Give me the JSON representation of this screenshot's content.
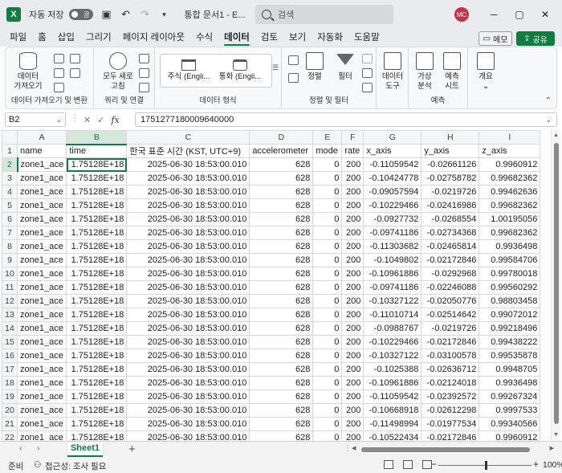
{
  "app": {
    "autosave_label": "자동 저장",
    "autosave_state": "끔",
    "doc_title": "통합 문서1 - E...",
    "search_placeholder": "검색",
    "user_initials": "MC"
  },
  "menu": {
    "tabs": [
      "파일",
      "홈",
      "삽입",
      "그리기",
      "페이지 레이아웃",
      "수식",
      "데이터",
      "검토",
      "보기",
      "자동화",
      "도움말"
    ],
    "active_tab": "데이터",
    "memo_label": "메모",
    "share_label": "공유"
  },
  "ribbon": {
    "groups": {
      "get_data": "데이터 가져오기 및 변환",
      "queries": "쿼리 및 연결",
      "data_types": "데이터 형식",
      "sort_filter": "정렬 및 필터",
      "forecast": "예측"
    },
    "buttons": {
      "get_data_line1": "데이터",
      "get_data_line2": "가져오기",
      "refresh_line1": "모두 새로",
      "refresh_line2": "고침",
      "stocks": "주식 (Engli...",
      "currency": "통화 (Engli...",
      "sort": "정렬",
      "filter": "필터",
      "data_tools_line1": "데이터",
      "data_tools_line2": "도구",
      "whatif_line1": "가상",
      "whatif_line2": "분석",
      "forecast_line1": "예측",
      "forecast_line2": "시트",
      "outline": "개요"
    }
  },
  "formula_bar": {
    "name_box": "B2",
    "fx": "fx",
    "value": "1751277180009640000"
  },
  "grid": {
    "columns": [
      "A",
      "B",
      "C",
      "D",
      "E",
      "F",
      "G",
      "H",
      "I"
    ],
    "header_row": [
      "name",
      "time",
      "한국 표준 시간 (KST, UTC+9)",
      "accelerometer",
      "mode",
      "rate",
      "x_axis",
      "y_axis",
      "z_axis"
    ],
    "rows": [
      [
        "zone1_ace",
        "1.75128E+18",
        "2025-06-30 18:53:00.010",
        "628",
        "0",
        "200",
        "-0.11059542",
        "-0.02661126",
        "0.9960912"
      ],
      [
        "zone1_ace",
        "1.75128E+18",
        "2025-06-30 18:53:00.010",
        "628",
        "0",
        "200",
        "-0.10424778",
        "-0.02758782",
        "0.99682362"
      ],
      [
        "zone1_ace",
        "1.75128E+18",
        "2025-06-30 18:53:00.010",
        "628",
        "0",
        "200",
        "-0.09057594",
        "-0.0219726",
        "0.99462636"
      ],
      [
        "zone1_ace",
        "1.75128E+18",
        "2025-06-30 18:53:00.010",
        "628",
        "0",
        "200",
        "-0.10229466",
        "-0.02416986",
        "0.99682362"
      ],
      [
        "zone1_ace",
        "1.75128E+18",
        "2025-06-30 18:53:00.010",
        "628",
        "0",
        "200",
        "-0.0927732",
        "-0.0268554",
        "1.00195056"
      ],
      [
        "zone1_ace",
        "1.75128E+18",
        "2025-06-30 18:53:00.010",
        "628",
        "0",
        "200",
        "-0.09741186",
        "-0.02734368",
        "0.99682362"
      ],
      [
        "zone1_ace",
        "1.75128E+18",
        "2025-06-30 18:53:00.010",
        "628",
        "0",
        "200",
        "-0.11303682",
        "-0.02465814",
        "0.9936498"
      ],
      [
        "zone1_ace",
        "1.75128E+18",
        "2025-06-30 18:53:00.010",
        "628",
        "0",
        "200",
        "-0.1049802",
        "-0.02172846",
        "0.99584706"
      ],
      [
        "zone1_ace",
        "1.75128E+18",
        "2025-06-30 18:53:00.010",
        "628",
        "0",
        "200",
        "-0.10961886",
        "-0.0292968",
        "0.99780018"
      ],
      [
        "zone1_ace",
        "1.75128E+18",
        "2025-06-30 18:53:00.010",
        "628",
        "0",
        "200",
        "-0.09741186",
        "-0.02246088",
        "0.99560292"
      ],
      [
        "zone1_ace",
        "1.75128E+18",
        "2025-06-30 18:53:00.010",
        "628",
        "0",
        "200",
        "-0.10327122",
        "-0.02050776",
        "0.98803458"
      ],
      [
        "zone1_ace",
        "1.75128E+18",
        "2025-06-30 18:53:00.010",
        "628",
        "0",
        "200",
        "-0.11010714",
        "-0.02514642",
        "0.99072012"
      ],
      [
        "zone1_ace",
        "1.75128E+18",
        "2025-06-30 18:53:00.010",
        "628",
        "0",
        "200",
        "-0.0988767",
        "-0.0219726",
        "0.99218496"
      ],
      [
        "zone1_ace",
        "1.75128E+18",
        "2025-06-30 18:53:00.010",
        "628",
        "0",
        "200",
        "-0.10229466",
        "-0.02172846",
        "0.99438222"
      ],
      [
        "zone1_ace",
        "1.75128E+18",
        "2025-06-30 18:53:00.010",
        "628",
        "0",
        "200",
        "-0.10327122",
        "-0.03100578",
        "0.99535878"
      ],
      [
        "zone1_ace",
        "1.75128E+18",
        "2025-06-30 18:53:00.010",
        "628",
        "0",
        "200",
        "-0.1025388",
        "-0.02636712",
        "0.9948705"
      ],
      [
        "zone1_ace",
        "1.75128E+18",
        "2025-06-30 18:53:00.010",
        "628",
        "0",
        "200",
        "-0.10961886",
        "-0.02124018",
        "0.9936498"
      ],
      [
        "zone1_ace",
        "1.75128E+18",
        "2025-06-30 18:53:00.010",
        "628",
        "0",
        "200",
        "-0.11059542",
        "-0.02392572",
        "0.99267324"
      ],
      [
        "zone1_ace",
        "1.75128E+18",
        "2025-06-30 18:53:00.010",
        "628",
        "0",
        "200",
        "-0.10668918",
        "-0.02612298",
        "0.9997533"
      ],
      [
        "zone1_ace",
        "1.75128E+18",
        "2025-06-30 18:53:00.010",
        "628",
        "0",
        "200",
        "-0.11498994",
        "-0.01977534",
        "0.99340566"
      ],
      [
        "zone1_ace",
        "1.75128E+18",
        "2025-06-30 18:53:00.010",
        "628",
        "0",
        "200",
        "-0.10522434",
        "-0.02172846",
        "0.9960912"
      ]
    ]
  },
  "sheets": {
    "tabs": [
      "Sheet1"
    ],
    "add_label": "+"
  },
  "status": {
    "ready": "준비",
    "accessibility": "접근성: 조사 필요",
    "zoom": "100%"
  }
}
